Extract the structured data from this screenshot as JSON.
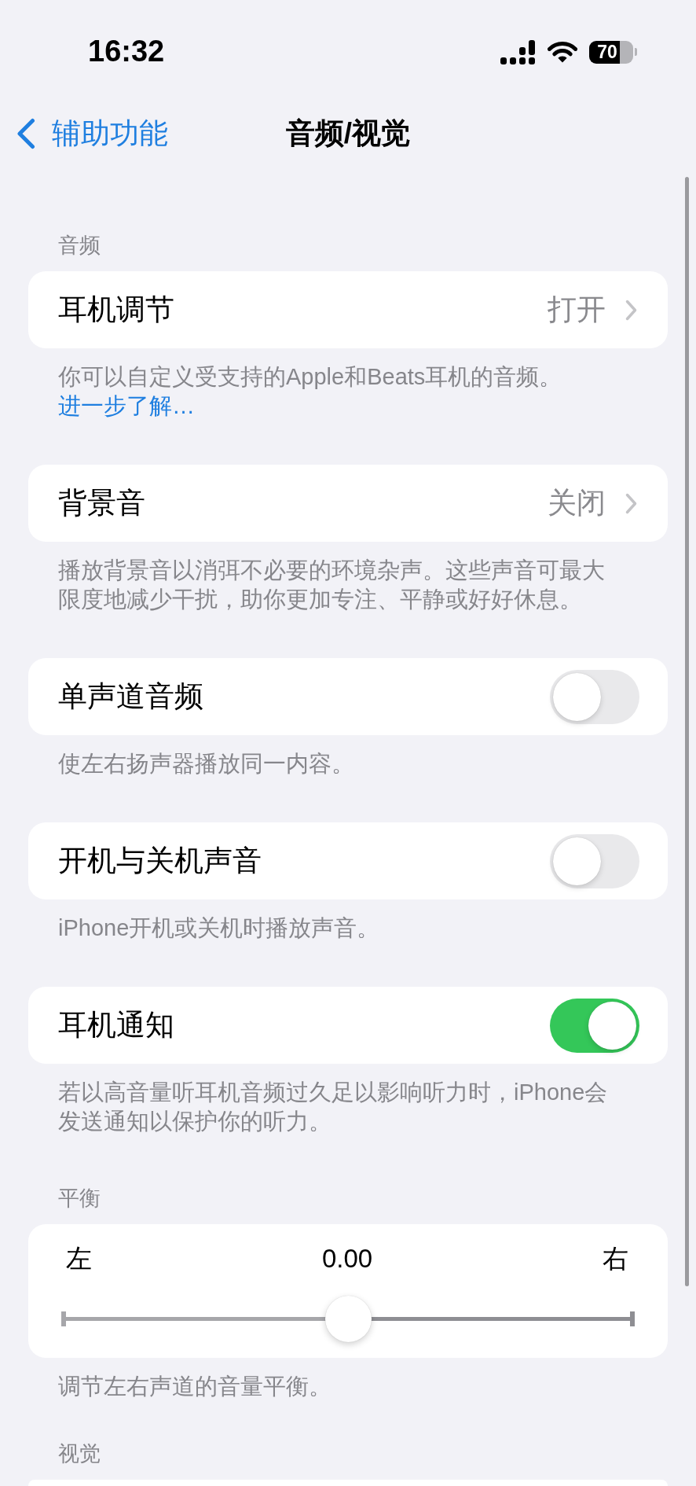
{
  "status_bar": {
    "time": "16:32",
    "battery": "70"
  },
  "nav_bar": {
    "back": "辅助功能",
    "title": "音频/视觉"
  },
  "groups": [
    {
      "header": "音频",
      "kind": "link",
      "label": "耳机调节",
      "value": "打开",
      "footer": "你可以自定义受支持的Apple和Beats耳机的音频。",
      "footer_link": "进一步了解…"
    },
    {
      "kind": "link",
      "label": "背景音",
      "value": "关闭",
      "footer": "播放背景音以消弭不必要的环境杂声。这些声音可最大限度地减少干扰，助你更加专注、平静或好好休息。"
    },
    {
      "kind": "toggle",
      "label": "单声道音频",
      "on": false,
      "footer": "使左右扬声器播放同一内容。"
    },
    {
      "kind": "toggle",
      "label": "开机与关机声音",
      "on": false,
      "footer": "iPhone开机或关机时播放声音。"
    },
    {
      "kind": "toggle",
      "label": "耳机通知",
      "on": true,
      "footer": "若以高音量听耳机音频过久足以影响听力时，iPhone会发送通知以保护你的听力。"
    },
    {
      "header": "平衡",
      "kind": "slider",
      "left_label": "左",
      "value": "0.00",
      "right_label": "右",
      "level": 0.5,
      "footer": "调节左右声道的音量平衡。"
    },
    {
      "header": "视觉",
      "kind": "partial"
    }
  ]
}
